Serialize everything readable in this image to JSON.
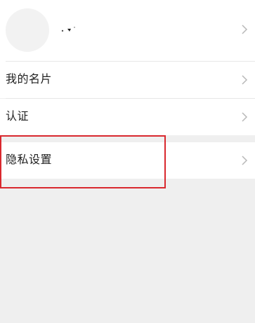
{
  "profile": {
    "name_display": ""
  },
  "menu": {
    "items": [
      {
        "label": "我的名片"
      },
      {
        "label": "认证"
      },
      {
        "label": "隐私设置"
      }
    ]
  },
  "colors": {
    "page_background": "#efefef",
    "row_background": "#ffffff",
    "highlight_border": "#d9282e",
    "chevron": "#b8b8b8"
  },
  "icons": [
    "chevron-right-icon"
  ]
}
